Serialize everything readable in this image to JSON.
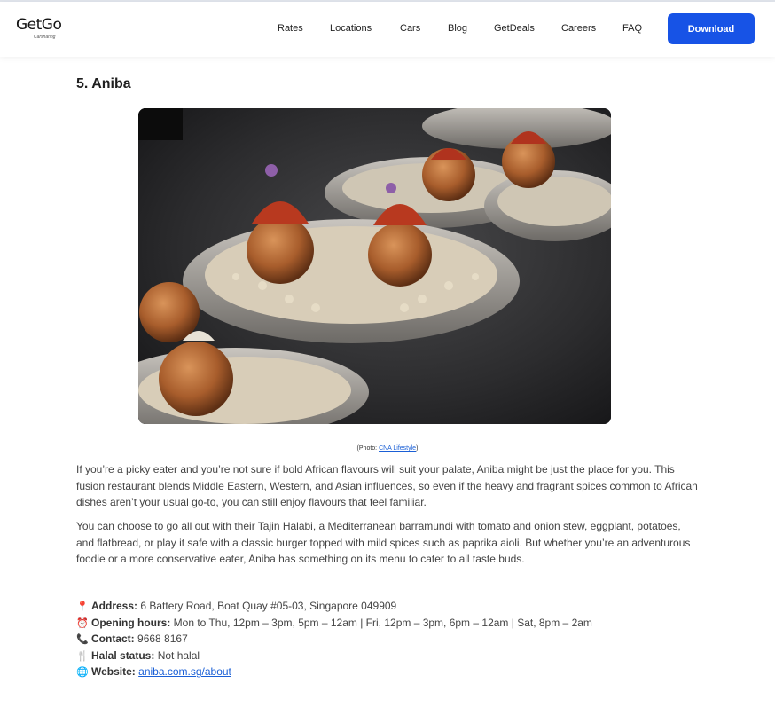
{
  "header": {
    "logo_text": "GetGo",
    "logo_sub": "Carsharing",
    "nav": [
      {
        "label": "Rates"
      },
      {
        "label": "Locations"
      },
      {
        "label": "Cars"
      },
      {
        "label": "Blog"
      },
      {
        "label": "GetDeals"
      },
      {
        "label": "Careers"
      },
      {
        "label": "FAQ"
      }
    ],
    "download_label": "Download",
    "accent_color": "#1753e6"
  },
  "article": {
    "heading": "5. Aniba",
    "image_alt": "Plated fried croquettes topped with tomato and herbs on beds of chickpeas",
    "caption_prefix": "(Photo: ",
    "caption_link": "CNA Lifestyle",
    "caption_suffix": ")",
    "paragraphs": [
      "If you’re a picky eater and you’re not sure if bold African flavours will suit your palate, Aniba might be just the place for you. This fusion restaurant blends Middle Eastern, Western, and Asian influences, so even if the heavy and fragrant spices common to African dishes aren’t your usual go-to, you can still enjoy flavours that feel familiar.",
      "You can choose to go all out with their Tajin Halabi, a Mediterranean barramundi with tomato and onion stew, eggplant, potatoes, and flatbread, or play it safe with a classic burger topped with mild spices such as paprika aioli. But whether you’re an adventurous foodie or a more conservative eater, Aniba has something on its menu to cater to all taste buds."
    ],
    "info": {
      "address": {
        "emoji": "📍",
        "label": "Address:",
        "value": "6 Battery Road, Boat Quay #05-03, Singapore 049909"
      },
      "hours": {
        "emoji": "⏰",
        "label": "Opening hours:",
        "value": "Mon to Thu, 12pm – 3pm, 5pm – 12am | Fri, 12pm – 3pm, 6pm – 12am | Sat, 8pm – 2am"
      },
      "contact": {
        "emoji": "📞",
        "label": "Contact:",
        "value": "9668 8167"
      },
      "halal": {
        "emoji": "🍴",
        "label": "Halal status:",
        "value": "Not halal"
      },
      "website": {
        "emoji": "🌐",
        "label": "Website:",
        "value": "aniba.com.sg/about"
      }
    }
  }
}
